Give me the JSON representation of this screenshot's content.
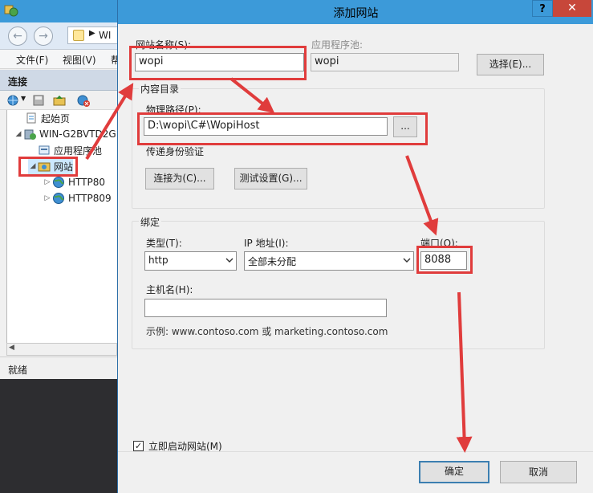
{
  "iis": {
    "address_text": "WI",
    "menu": {
      "file": "文件(F)",
      "view": "视图(V)",
      "more": "帮"
    },
    "connections_header": "连接",
    "tree": [
      {
        "label": "起始页"
      },
      {
        "label": "WIN-G2BVTD2G"
      },
      {
        "label": "应用程序池"
      },
      {
        "label": "网站"
      },
      {
        "label": "HTTP80"
      },
      {
        "label": "HTTP809"
      }
    ],
    "status": "就绪"
  },
  "dialog": {
    "title": "添加网站",
    "help_label": "?",
    "close_label": "✕",
    "site_name": {
      "label": "网站名称(S):",
      "value": "wopi"
    },
    "app_pool": {
      "label": "应用程序池:",
      "value": "wopi",
      "select_button": "选择(E)..."
    },
    "content_dir": {
      "group_label": "内容目录",
      "physical_path_label": "物理路径(P):",
      "physical_path_value": "D:\\wopi\\C#\\WopiHost",
      "browse_button": "...",
      "pass_through_label": "传递身份验证",
      "connect_as_button": "连接为(C)...",
      "test_settings_button": "测试设置(G)..."
    },
    "binding": {
      "group_label": "绑定",
      "type_label": "类型(T):",
      "type_value": "http",
      "ip_label": "IP 地址(I):",
      "ip_value": "全部未分配",
      "port_label": "端口(O):",
      "port_value": "8088",
      "host_label": "主机名(H):",
      "host_value": "",
      "example": "示例: www.contoso.com 或 marketing.contoso.com"
    },
    "autostart_label": "立即启动网站(M)",
    "ok_button": "确定",
    "cancel_button": "取消"
  },
  "annotation_color": "#e03c3c"
}
